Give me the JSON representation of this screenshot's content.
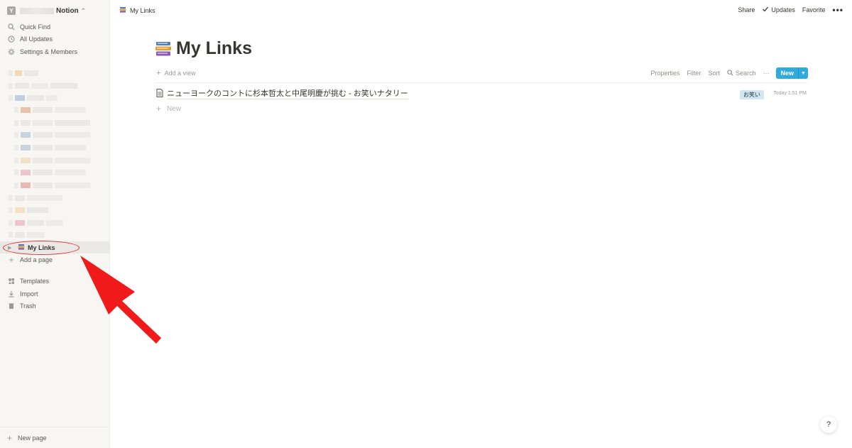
{
  "sidebar": {
    "workspace_name": "Notion",
    "workspace_initial": "Y",
    "nav": [
      {
        "label": "Quick Find",
        "icon": "search-icon"
      },
      {
        "label": "All Updates",
        "icon": "clock-icon"
      },
      {
        "label": "Settings & Members",
        "icon": "gear-icon"
      }
    ],
    "selected_page": "My Links",
    "add_page": "Add a page",
    "bottom": [
      {
        "label": "Templates",
        "icon": "templates-icon"
      },
      {
        "label": "Import",
        "icon": "import-icon"
      },
      {
        "label": "Trash",
        "icon": "trash-icon"
      }
    ],
    "new_page": "New page"
  },
  "topbar": {
    "breadcrumb": "My Links",
    "share": "Share",
    "updates": "Updates",
    "favorite": "Favorite",
    "more": "•••"
  },
  "page": {
    "title": "My Links",
    "add_view": "Add a view",
    "actions": {
      "properties": "Properties",
      "filter": "Filter",
      "sort": "Sort",
      "search": "Search",
      "more": "···",
      "new": "New"
    },
    "rows": [
      {
        "title": "ニューヨークのコントに杉本哲太と中尾明慶が挑む - お笑いナタリー",
        "tag": "お笑い",
        "time": "Today 1:51 PM"
      }
    ],
    "new_row": "New"
  },
  "help": "?",
  "colors": {
    "accent": "#2eaadc",
    "sidebar_bg": "#f7f6f3",
    "annotation_red": "#e12b2b",
    "tag_bg": "#d3e5ef"
  }
}
